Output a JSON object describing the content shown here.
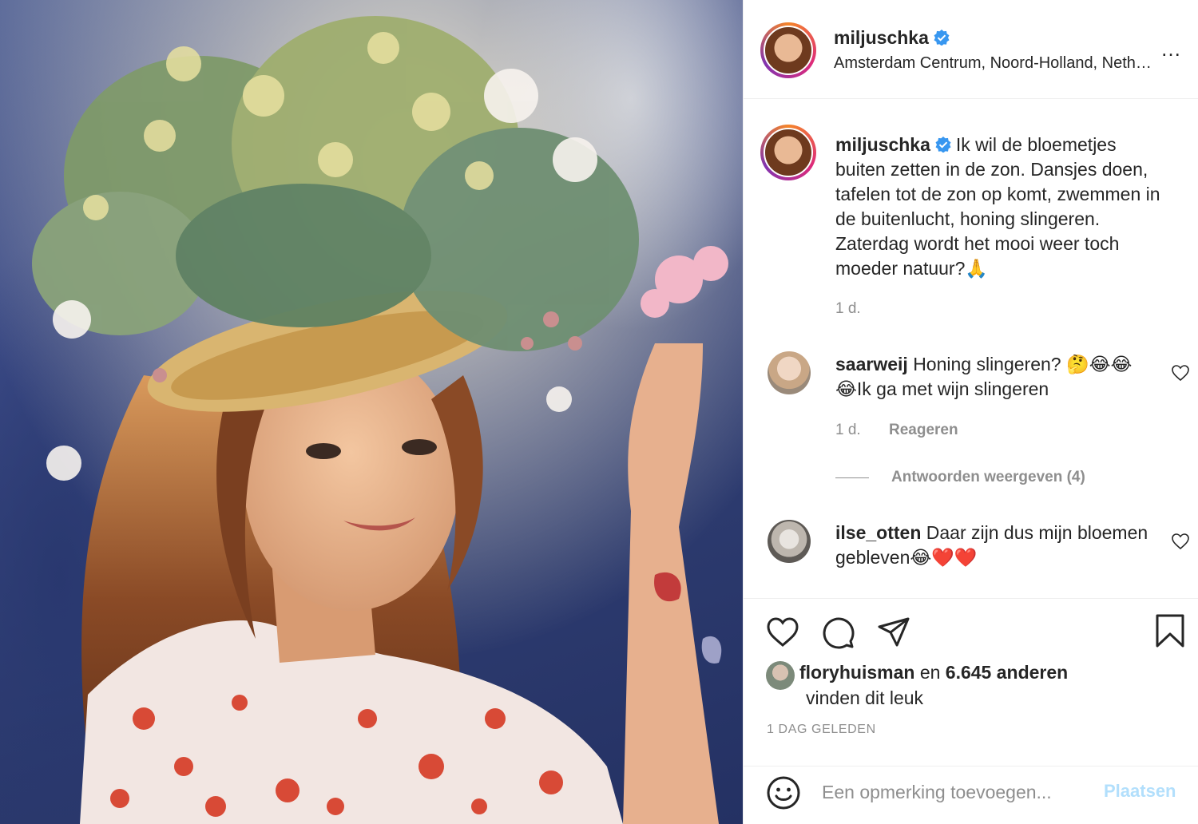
{
  "post": {
    "image_alt": "Photo of a woman wearing a straw hat decorated with eucalyptus and flowers",
    "colors": {
      "verified_blue": "#3897f0",
      "like_red": "#ed4956",
      "post_button": "#b2dffc",
      "muted": "#8e8e8e"
    }
  },
  "header": {
    "username": "miljuschka",
    "verified_icon": "verified-badge-icon",
    "location": "Amsterdam Centrum, Noord-Holland, Neth…",
    "more_icon": "more-options-icon",
    "more_label": "…"
  },
  "caption": {
    "username": "miljuschka",
    "text": "Ik wil de bloemetjes buiten zetten in de zon. Dansjes doen, tafelen tot de zon op komt, zwemmen in de buitenlucht, honing slingeren. Zaterdag wordt het mooi weer toch moeder natuur?🙏",
    "time": "1 d."
  },
  "comments": [
    {
      "username": "saarweij",
      "text": "Honing slingeren? 🤔😂😂😂Ik ga met wijn slingeren",
      "time": "1 d.",
      "reply_label": "Reageren",
      "view_replies": "Antwoorden weergeven (4)"
    },
    {
      "username": "ilse_otten",
      "text": "Daar zijn dus mijn bloemen gebleven😂❤️❤️"
    }
  ],
  "actions": {
    "like_icon": "heart-icon",
    "comment_icon": "comment-icon",
    "share_icon": "share-icon",
    "save_icon": "bookmark-icon"
  },
  "likes": {
    "first_liker": "floryhuisman",
    "connector": "en",
    "others": "6.645 anderen",
    "suffix": "vinden dit leuk"
  },
  "timestamp": "1 DAG GELEDEN",
  "composer": {
    "emoji_icon": "emoji-icon",
    "placeholder": "Een opmerking toevoegen...",
    "post_label": "Plaatsen"
  }
}
